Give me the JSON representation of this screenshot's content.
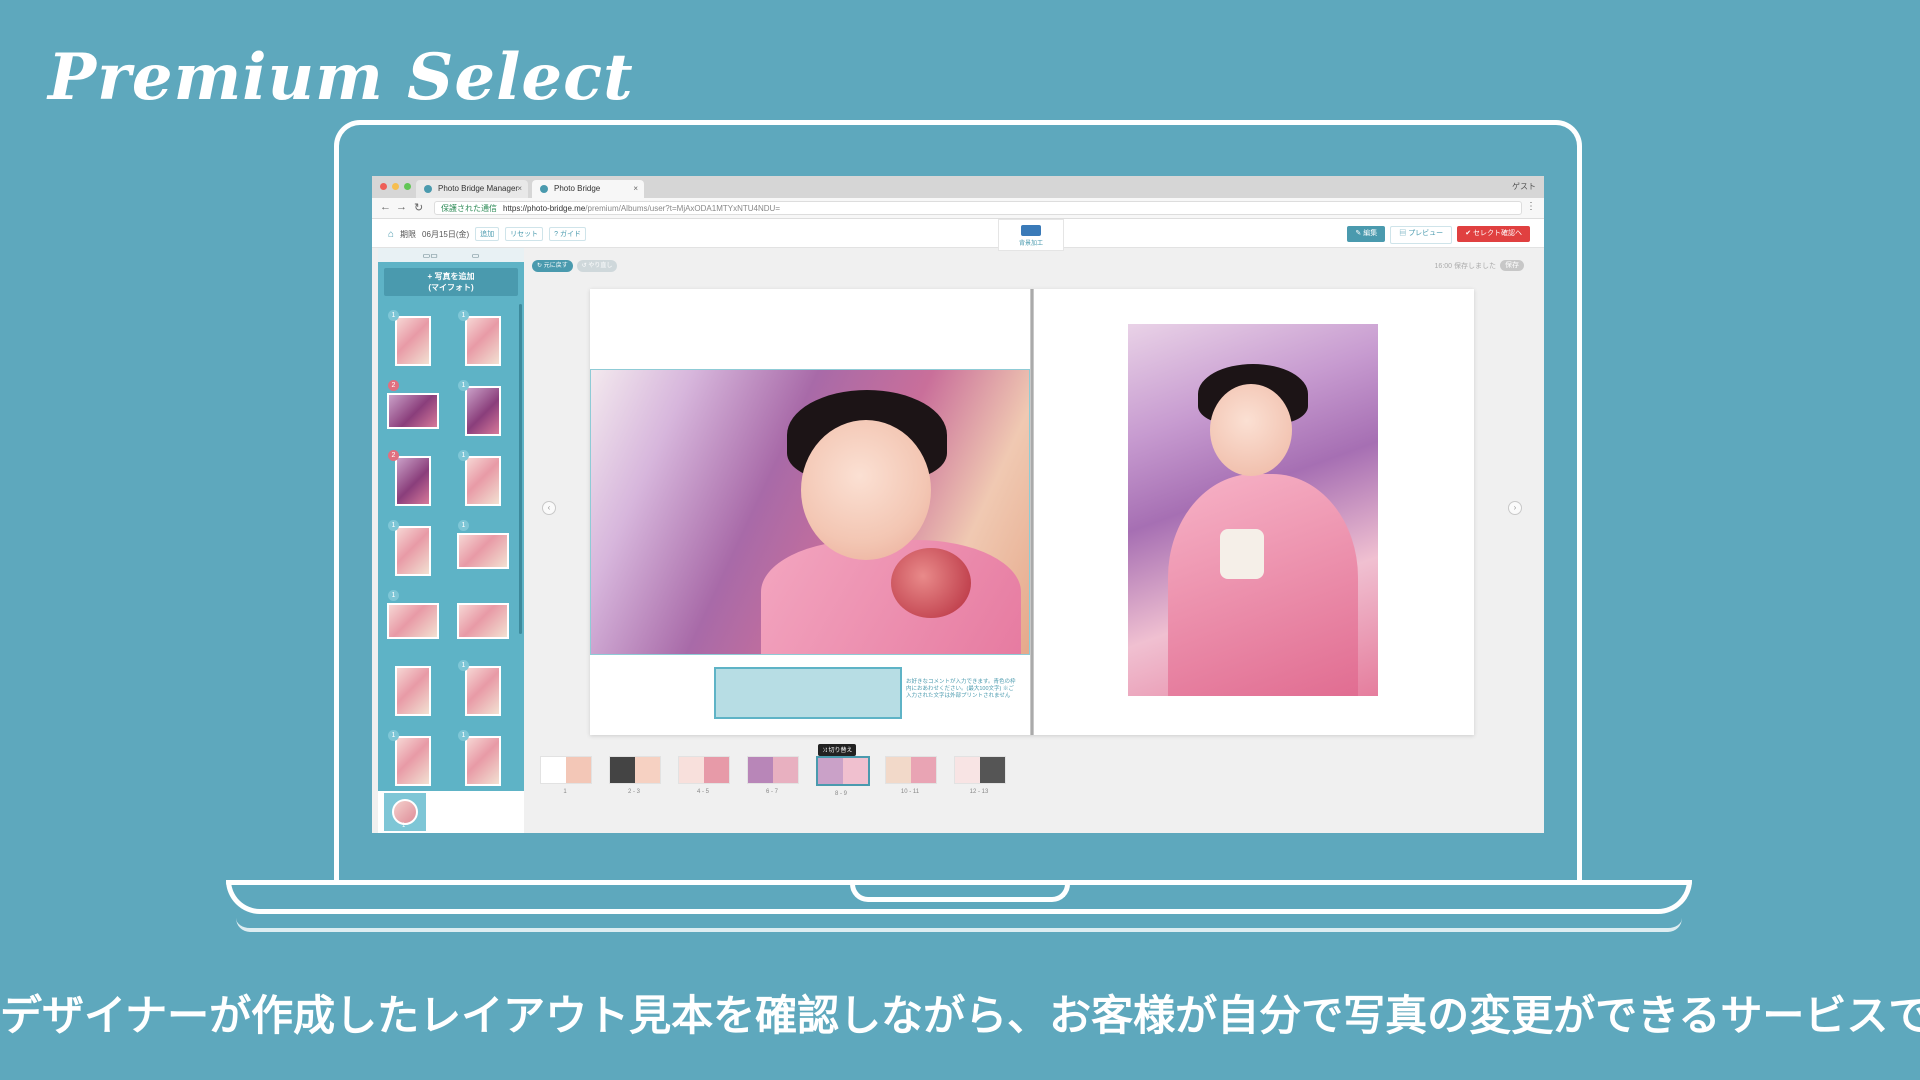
{
  "brand": {
    "title": "Premium Select"
  },
  "caption": "デザイナーが作成したレイアウト見本を確認しながら、お客様が自分で写真の変更ができるサービスです。",
  "colors": {
    "background": "#5ea8bd",
    "accent": "#4a9aae",
    "confirm": "#e04040"
  },
  "browser": {
    "tabs": [
      {
        "label": "Photo Bridge Manager",
        "active": false
      },
      {
        "label": "Photo Bridge",
        "active": true
      }
    ],
    "profile_label": "ゲスト",
    "security_label": "保護された通信",
    "url_host": "https://photo-bridge.me",
    "url_path": "/premium/Albums/user?t=MjAxODA1MTYxNTU4NDU="
  },
  "toolbar": {
    "deadline_label": "期限",
    "deadline_date": "06月15日(金)",
    "chips": [
      "追加",
      "リセット",
      "? ガイド"
    ],
    "center_tool_label": "背景加工",
    "edit_label": "編集",
    "preview_label": "プレビュー",
    "confirm_label": "✔ セレクト確認へ"
  },
  "sidebar": {
    "add_photo_line1": "+ 写真を追加",
    "add_photo_line2": "(マイフォト)",
    "thumbnails": [
      {
        "orient": "p",
        "dark": false,
        "count": "1",
        "red": false
      },
      {
        "orient": "p",
        "dark": false,
        "count": "1",
        "red": false
      },
      {
        "orient": "l",
        "dark": true,
        "count": "2",
        "red": true
      },
      {
        "orient": "p",
        "dark": true,
        "count": "1",
        "red": false
      },
      {
        "orient": "p",
        "dark": true,
        "count": "2",
        "red": true
      },
      {
        "orient": "p",
        "dark": false,
        "count": "1",
        "red": false
      },
      {
        "orient": "p",
        "dark": false,
        "count": "1",
        "red": false
      },
      {
        "orient": "l",
        "dark": false,
        "count": "1",
        "red": false
      },
      {
        "orient": "l",
        "dark": false,
        "count": "1",
        "red": false
      },
      {
        "orient": "l",
        "dark": false,
        "count": "",
        "red": false
      },
      {
        "orient": "p",
        "dark": false,
        "count": "",
        "red": false
      },
      {
        "orient": "p",
        "dark": false,
        "count": "1",
        "red": false
      },
      {
        "orient": "p",
        "dark": false,
        "count": "1",
        "red": false
      },
      {
        "orient": "p",
        "dark": false,
        "count": "1",
        "red": false
      }
    ],
    "bottom_page_label": "1"
  },
  "editor": {
    "undo_label": "↻ 元に戻す",
    "redo_label": "↺ やり直し",
    "saved_text": "16:00 保存しました",
    "save_label": "保存",
    "comment_hint": "お好きなコメントが入力できます。青色の枠内におあわせください。(最大100文字) ※ご入力された文字は外部プリントされません"
  },
  "pages": {
    "swap_label": "⤨ 切り替え",
    "items": [
      {
        "label": "1",
        "selected": false
      },
      {
        "label": "2 - 3",
        "selected": false
      },
      {
        "label": "4 - 5",
        "selected": false
      },
      {
        "label": "6 - 7",
        "selected": false
      },
      {
        "label": "8 - 9",
        "selected": true
      },
      {
        "label": "10 - 11",
        "selected": false
      },
      {
        "label": "12 - 13",
        "selected": false
      }
    ]
  }
}
